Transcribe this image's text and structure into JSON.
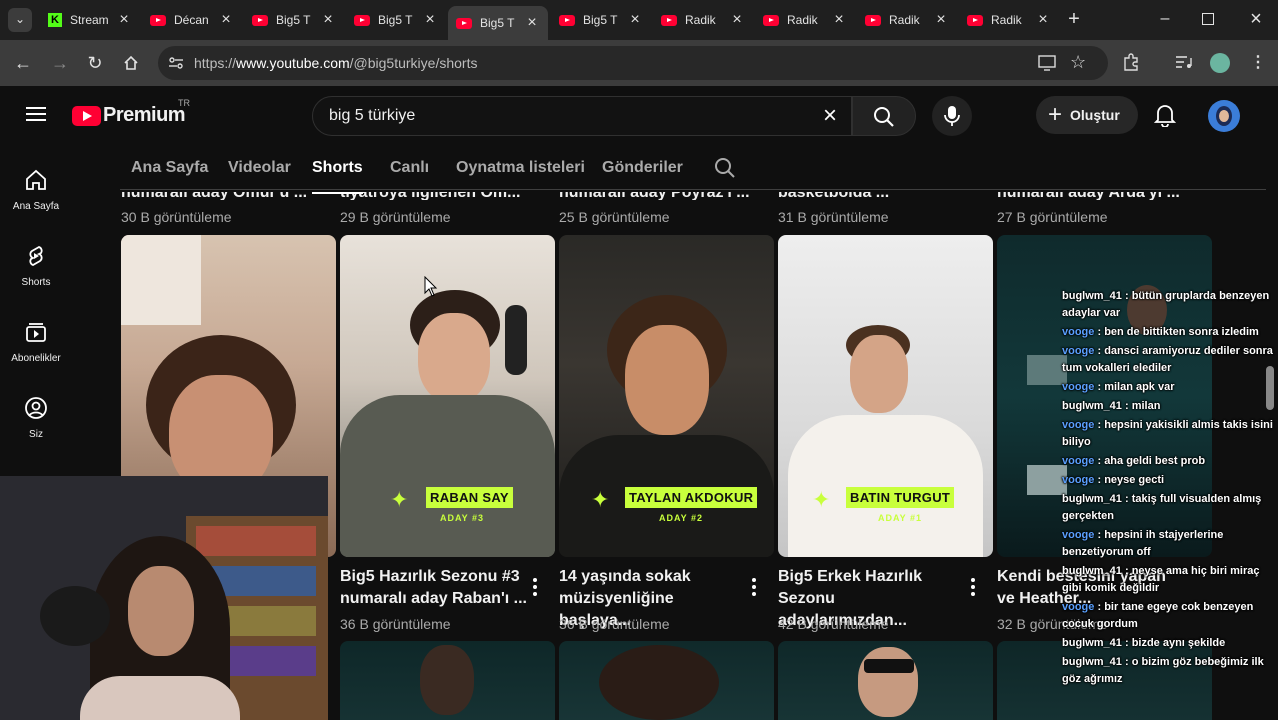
{
  "browser": {
    "tabs": [
      {
        "title": "Stream",
        "icon": "kick-icon"
      },
      {
        "title": "Décan",
        "icon": "youtube-icon"
      },
      {
        "title": "Big5 T",
        "icon": "youtube-icon"
      },
      {
        "title": "Big5 T",
        "icon": "youtube-icon"
      },
      {
        "title": "Big5 T",
        "icon": "youtube-icon",
        "active": true
      },
      {
        "title": "Big5 T",
        "icon": "youtube-icon"
      },
      {
        "title": "Radik",
        "icon": "youtube-icon"
      },
      {
        "title": "Radik",
        "icon": "youtube-icon"
      },
      {
        "title": "Radik",
        "icon": "youtube-icon"
      },
      {
        "title": "Radik",
        "icon": "youtube-icon"
      }
    ],
    "url_prefix": "https://",
    "url_host": "www.youtube.com",
    "url_path": "/@big5turkiye/shorts"
  },
  "youtube": {
    "logo_text": "Premium",
    "logo_region": "TR",
    "search_value": "big 5 türkiye",
    "create_label": "Oluştur",
    "sidebar": [
      {
        "label": "Ana Sayfa",
        "icon": "home-icon"
      },
      {
        "label": "Shorts",
        "icon": "shorts-icon"
      },
      {
        "label": "Abonelikler",
        "icon": "subscriptions-icon"
      },
      {
        "label": "Siz",
        "icon": "user-icon"
      }
    ],
    "channel_tabs": [
      "Ana Sayfa",
      "Videolar",
      "Shorts",
      "Canlı",
      "Oynatma listeleri",
      "Gönderiler"
    ],
    "active_tab": "Shorts",
    "prev_row": [
      {
        "title": "numaralı aday Ömür'ü ...",
        "views": "30 B görüntüleme"
      },
      {
        "title": "tiyatroya ilgilenen Öm...",
        "views": "29 B görüntüleme"
      },
      {
        "title": "numaralı aday Poyraz'ı ...",
        "views": "25 B görüntüleme"
      },
      {
        "title": "basketbolda ...",
        "views": "31 B görüntüleme"
      },
      {
        "title": "numaralı aday Arda'yı ...",
        "views": "27 B görüntüleme"
      }
    ],
    "cards": [
      {
        "title": "Big5 Hazırlık Sezonu #3 numaralı aday Raban'ı ...",
        "views": "36 B görüntüleme",
        "tag_name": "RABAN SAY",
        "tag_aday": "ADAY #3"
      },
      {
        "title": "14 yaşında sokak müzisyenliğine başlaya...",
        "views": "36 B görüntüleme",
        "tag_name": "TAYLAN AKDOKUR",
        "tag_aday": "ADAY #2"
      },
      {
        "title": "Big5 Erkek Hazırlık Sezonu adaylarımızdan...",
        "views": "42 B görüntüleme",
        "tag_name": "BATIN TURGUT",
        "tag_aday": "ADAY #1"
      },
      {
        "title": "Kendi bestesini yapan ve Heather...",
        "views": "32 B görüntüleme"
      }
    ]
  },
  "chat": [
    {
      "user": "buglwm_41",
      "text": "bütün gruplarda benzeyen adaylar var",
      "color": "white"
    },
    {
      "user": "vooge",
      "text": "ben de bittikten sonra izledim",
      "color": "blue"
    },
    {
      "user": "vooge",
      "text": "dansci aramiyoruz dediler sonra tum vokalleri elediler",
      "color": "blue"
    },
    {
      "user": "vooge",
      "text": "milan apk var",
      "color": "blue"
    },
    {
      "user": "buglwm_41",
      "text": "milan",
      "color": "white"
    },
    {
      "user": "vooge",
      "text": "hepsini yakisikli almis takis isini biliyo",
      "color": "blue"
    },
    {
      "user": "vooge",
      "text": "aha geldi best prob",
      "color": "blue"
    },
    {
      "user": "vooge",
      "text": "neyse gecti",
      "color": "blue"
    },
    {
      "user": "buglwm_41",
      "text": "takiş full visualden almış gerçekten",
      "color": "white"
    },
    {
      "user": "vooge",
      "text": "hepsini ih stajyerlerine benzetiyorum off",
      "color": "blue"
    },
    {
      "user": "buglwm_41",
      "text": "neyse ama hiç biri miraç gibi komik değildir",
      "color": "white"
    },
    {
      "user": "vooge",
      "text": "bir tane egeye cok benzeyen cocuk gordum",
      "color": "blue"
    },
    {
      "user": "buglwm_41",
      "text": "bizde aynı şekilde",
      "color": "white"
    },
    {
      "user": "buglwm_41",
      "text": "o bizim göz bebeğimiz ilk göz ağrımız",
      "color": "white"
    }
  ]
}
